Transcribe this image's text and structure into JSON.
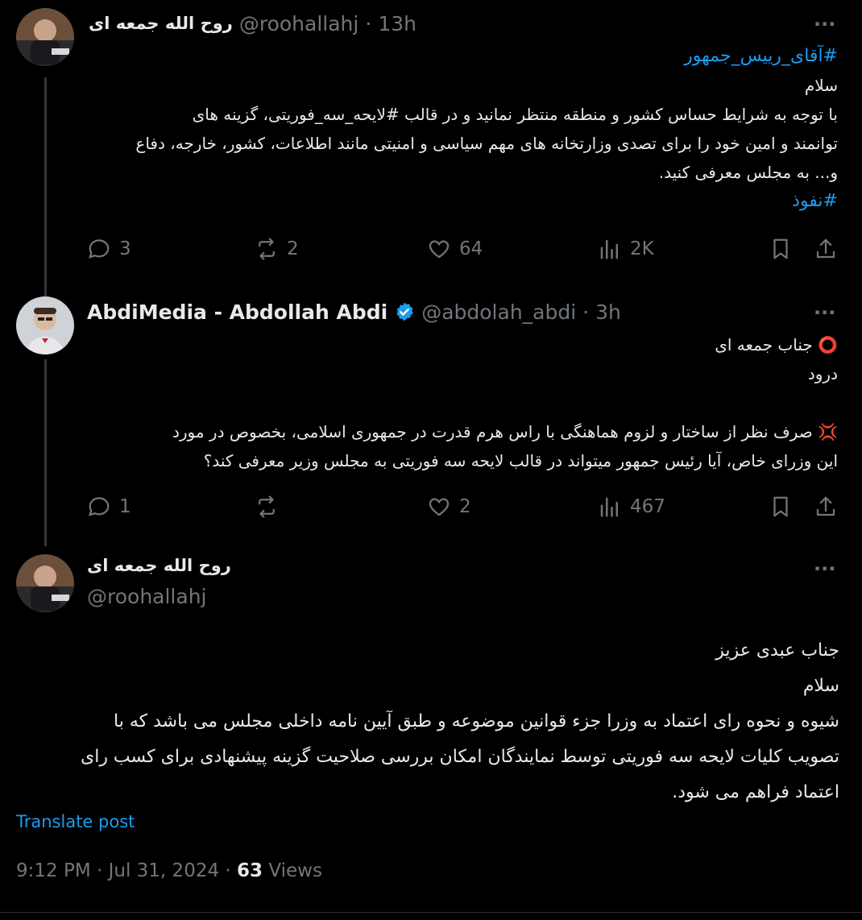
{
  "tweet1": {
    "display_name": "روح الله جمعه ای",
    "handle": "@roohallahj",
    "time": "13h",
    "lines": [
      "#آقای_رییس_جمهور",
      "سلام",
      "با توجه به شرایط حساس کشور و منطقه منتظر نمانید و در قالب #لایحه_سه_فوریتی، گزینه های",
      "توانمند و امین خود را برای تصدی وزارتخانه های مهم سیاسی و امنیتی مانند اطلاعات، کشور، خارجه، دفاع",
      "و... به مجلس معرفی کنید.",
      "#نفوذ"
    ],
    "replies": "3",
    "reposts": "2",
    "likes": "64",
    "views": "2K"
  },
  "tweet2": {
    "display_name": "AbdiMedia - Abdollah Abdi",
    "handle": "@abdolah_abdi",
    "time": "3h",
    "line1": "جناب جمعه ای",
    "line2": "درود",
    "line3": "صرف نظر از ساختار و لزوم هماهنگی با راس هرم قدرت در جمهوری اسلامی، بخصوص در مورد",
    "line4": "این وزرای خاص، آیا رئیس جمهور میتواند در قالب لایحه سه فوریتی به مجلس وزیر معرفی کند؟",
    "emoji1": "⭕",
    "emoji2": "💢",
    "replies": "1",
    "reposts": "",
    "likes": "2",
    "views": "467"
  },
  "main_tweet": {
    "display_name": "روح الله جمعه ای",
    "handle": "@roohallahj",
    "lines": [
      "جناب عبدی عزیز",
      "سلام",
      "شیوه و نحوه رای اعتماد به وزرا جزء قوانین موضوعه و طبق آیین نامه داخلی مجلس می باشد که با",
      "تصویب کلیات لایحه سه فوریتی توسط نمایندگان امکان بررسی صلاحیت گزینه پیشنهادی برای کسب رای",
      "اعتماد فراهم می شود."
    ],
    "translate_label": "Translate post",
    "timestamp": "9:12 PM · Jul 31, 2024 ·",
    "views_count": "63",
    "views_label": "Views"
  },
  "more_symbol": "···",
  "separator": "·",
  "colors": {
    "accent": "#1d9bf0",
    "muted": "#71767b",
    "text": "#e7e9ea",
    "background": "#000000"
  }
}
